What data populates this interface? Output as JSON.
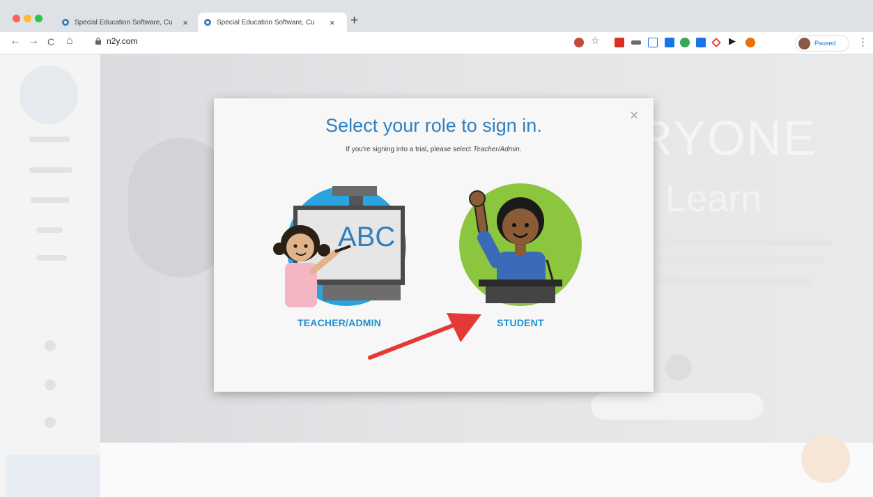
{
  "browser": {
    "tabs": [
      {
        "title": "Special Education Software, Cu",
        "active": false
      },
      {
        "title": "Special Education Software, Cu",
        "active": true
      }
    ],
    "close_glyph": "×",
    "new_tab_glyph": "+",
    "url": "n2y.com",
    "profile_status": "Paused",
    "nav": {
      "back": "←",
      "forward": "→",
      "reload": "C",
      "home": "⌂"
    },
    "menu_glyph": "⋮",
    "traffic_lights": [
      "#fe5f57",
      "#febc2e",
      "#28c840"
    ],
    "extension_colors": [
      "#c5483a",
      "#6c6c6c",
      "#1a73e8",
      "#d93025",
      "#34a853",
      "#1a73e8",
      "#ea4335",
      "#202124",
      "#e8710a"
    ]
  },
  "background_page": {
    "headline_1": "RYONE",
    "headline_2": "Learn"
  },
  "modal": {
    "title": "Select your role to sign in.",
    "subtitle_prefix": "If you're signing into a trial, please select ",
    "subtitle_em": "Teacher/Admin",
    "subtitle_suffix": ".",
    "close_label": "×",
    "roles": [
      {
        "label": "TEACHER/ADMIN",
        "icon": "teacher-illustration-icon",
        "circle_color": "#2aa4de"
      },
      {
        "label": "STUDENT",
        "icon": "student-illustration-icon",
        "circle_color": "#8cc63f"
      }
    ],
    "board_text": "ABC",
    "accent": "#2f7fc1",
    "arrow_color": "#e53935"
  }
}
